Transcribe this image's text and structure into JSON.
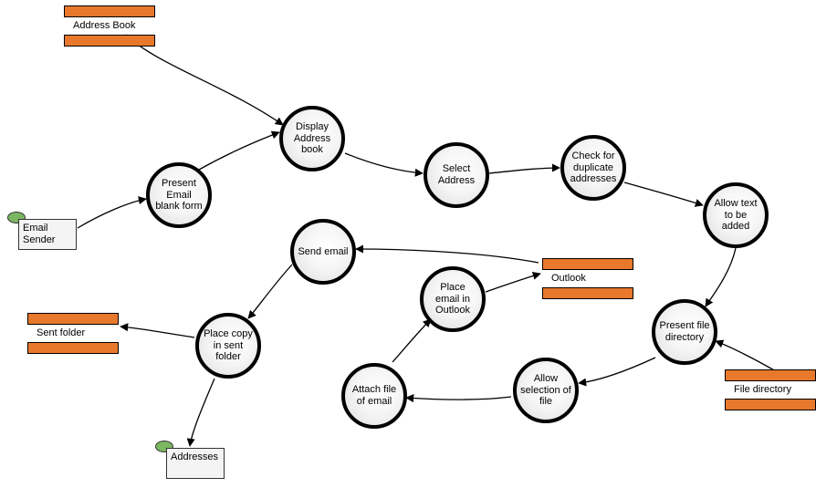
{
  "chart_data": {
    "type": "flow",
    "processes": [
      {
        "id": "present_form",
        "label": "Present Email blank form"
      },
      {
        "id": "display_book",
        "label": "Display Address book"
      },
      {
        "id": "select_addr",
        "label": "Select Address"
      },
      {
        "id": "check_dup",
        "label": "Check for duplicate addresses"
      },
      {
        "id": "allow_text",
        "label": "Allow text to be added"
      },
      {
        "id": "present_dir",
        "label": "Present file directory"
      },
      {
        "id": "allow_sel_file",
        "label": "Allow selection of file"
      },
      {
        "id": "attach_file",
        "label": "Attach file of email"
      },
      {
        "id": "place_outlook",
        "label": "Place email in Outlook"
      },
      {
        "id": "send_email",
        "label": "Send email"
      },
      {
        "id": "place_copy",
        "label": "Place copy in sent folder"
      }
    ],
    "data_stores": [
      {
        "id": "ds_address_book",
        "label": "Address Book"
      },
      {
        "id": "ds_outlook",
        "label": "Outlook"
      },
      {
        "id": "ds_file_dir",
        "label": "File directory"
      },
      {
        "id": "ds_sent",
        "label": "Sent folder"
      }
    ],
    "external_entities": [
      {
        "id": "ext_sender",
        "label": "Email Sender"
      },
      {
        "id": "ext_addresses",
        "label": "Addresses"
      }
    ],
    "edges": [
      {
        "from": "ds_address_book",
        "to": "display_book"
      },
      {
        "from": "ext_sender",
        "to": "present_form"
      },
      {
        "from": "present_form",
        "to": "display_book"
      },
      {
        "from": "display_book",
        "to": "select_addr"
      },
      {
        "from": "select_addr",
        "to": "check_dup"
      },
      {
        "from": "check_dup",
        "to": "allow_text"
      },
      {
        "from": "allow_text",
        "to": "present_dir"
      },
      {
        "from": "ds_file_dir",
        "to": "present_dir"
      },
      {
        "from": "present_dir",
        "to": "allow_sel_file"
      },
      {
        "from": "allow_sel_file",
        "to": "attach_file"
      },
      {
        "from": "attach_file",
        "to": "place_outlook"
      },
      {
        "from": "place_outlook",
        "to": "ds_outlook"
      },
      {
        "from": "ds_outlook",
        "to": "send_email"
      },
      {
        "from": "send_email",
        "to": "place_copy"
      },
      {
        "from": "place_copy",
        "to": "ds_sent"
      },
      {
        "from": "place_copy",
        "to": "ext_addresses"
      }
    ]
  },
  "labels": {
    "address_book": "Address Book",
    "outlook": "Outlook",
    "file_directory": "File directory",
    "sent_folder": "Sent folder",
    "email_sender": "Email Sender",
    "addresses": "Addresses",
    "present_form": "Present Email blank form",
    "display_book": "Display Address book",
    "select_addr": "Select Address",
    "check_dup": "Check for duplicate addresses",
    "allow_text": "Allow text to be added",
    "present_dir": "Present file directory",
    "allow_sel_file": "Allow selection of file",
    "attach_file": "Attach file of email",
    "place_outlook": "Place email in Outlook",
    "send_email": "Send email",
    "place_copy": "Place copy in sent folder"
  }
}
